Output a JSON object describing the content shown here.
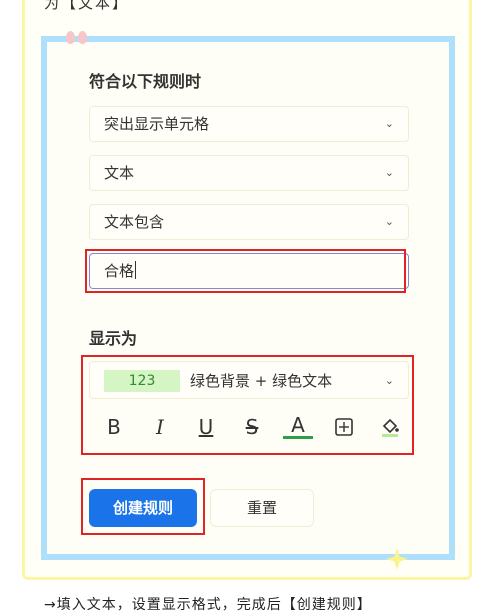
{
  "top_text": "为【文本】",
  "rule_section": {
    "title": "符合以下规则时",
    "condition_type": "突出显示单元格",
    "target": "文本",
    "operator": "文本包含",
    "input_value": "合格"
  },
  "display_section": {
    "title": "显示为",
    "preview": "123",
    "format_label": "绿色背景 + 绿色文本",
    "tools": [
      "B",
      "I",
      "U",
      "S",
      "A"
    ]
  },
  "buttons": {
    "create": "创建规则",
    "reset": "重置"
  },
  "caption": "→填入文本，设置显示格式，完成后【创建规则】",
  "colors": {
    "accent": "#1a73e8",
    "highlight": "#e02424",
    "frame": "#aee0fb"
  }
}
